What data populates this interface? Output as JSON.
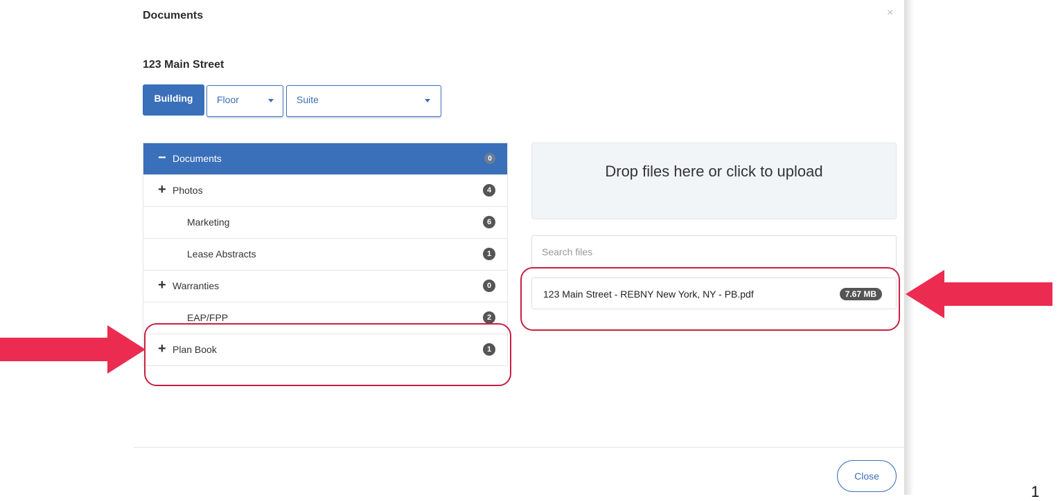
{
  "modal": {
    "title": "Documents",
    "close_icon": "close-icon"
  },
  "building": {
    "name": "123 Main Street"
  },
  "filters": {
    "building_label": "Building",
    "floor_label": "Floor",
    "suite_label": "Suite"
  },
  "tree": {
    "items": [
      {
        "label": "Documents",
        "symbol": "−",
        "count": "0"
      },
      {
        "label": "Photos",
        "symbol": "+",
        "count": "4"
      },
      {
        "label": "Marketing",
        "symbol": "",
        "count": "6"
      },
      {
        "label": "Lease Abstracts",
        "symbol": "",
        "count": "1"
      },
      {
        "label": "Warranties",
        "symbol": "+",
        "count": "0"
      },
      {
        "label": "EAP/FPP",
        "symbol": "",
        "count": "2"
      },
      {
        "label": "Plan Book",
        "symbol": "+",
        "count": "1"
      }
    ]
  },
  "upload": {
    "dropzone_text": "Drop files here or click to upload",
    "search_placeholder": "Search files"
  },
  "files": [
    {
      "name": "123 Main Street - REBNY New York, NY - PB.pdf",
      "size": "7.67 MB"
    }
  ],
  "footer": {
    "close_label": "Close"
  },
  "page_number": "1",
  "colors": {
    "primary": "#3a6fb9",
    "callout": "#c8203f",
    "arrow": "#ec2b51",
    "badge": "#555555"
  }
}
